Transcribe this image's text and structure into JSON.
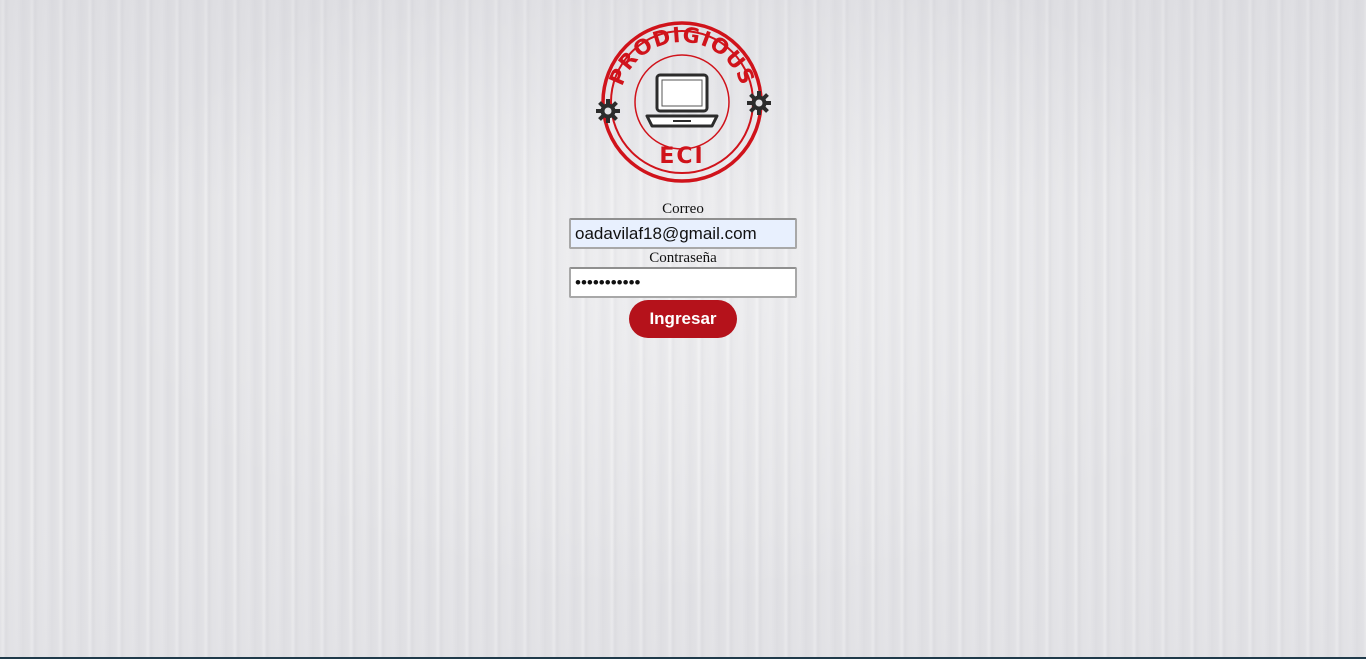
{
  "logo": {
    "top_text": "PRODIGIOUS",
    "bottom_text": "ECI",
    "color": "#d0131b"
  },
  "login_form": {
    "email_label": "Correo",
    "email_value": "oadavilaf18@gmail.com",
    "password_label": "Contraseña",
    "password_value": "•••••••••••",
    "submit_label": "Ingresar"
  },
  "colors": {
    "accent": "#b5121b",
    "background": "#e3e3e6"
  }
}
